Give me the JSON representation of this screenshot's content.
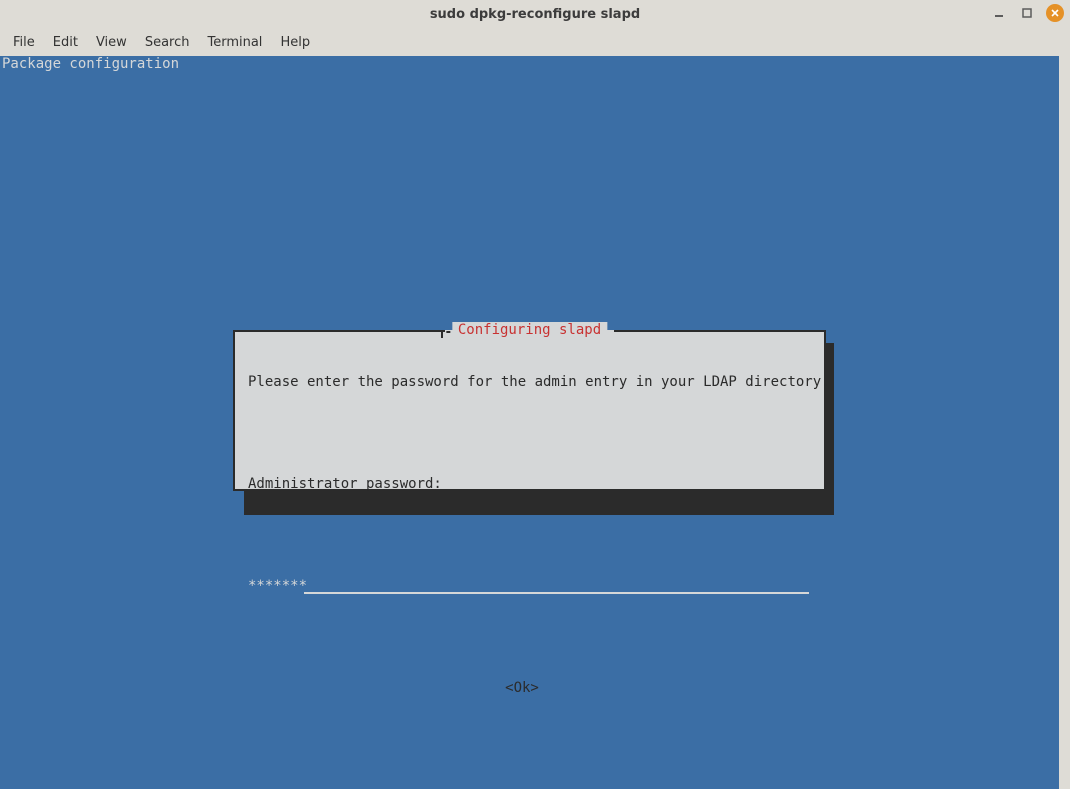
{
  "window": {
    "title": "sudo dpkg-reconfigure slapd"
  },
  "menubar": {
    "items": [
      "File",
      "Edit",
      "View",
      "Search",
      "Terminal",
      "Help"
    ]
  },
  "terminal": {
    "header": "Package configuration"
  },
  "dialog": {
    "title": "Configuring slapd",
    "prompt": "Please enter the password for the admin entry in your LDAP directory.",
    "field_label": "Administrator password:",
    "field_value": "*******",
    "ok_label": "<Ok>"
  }
}
